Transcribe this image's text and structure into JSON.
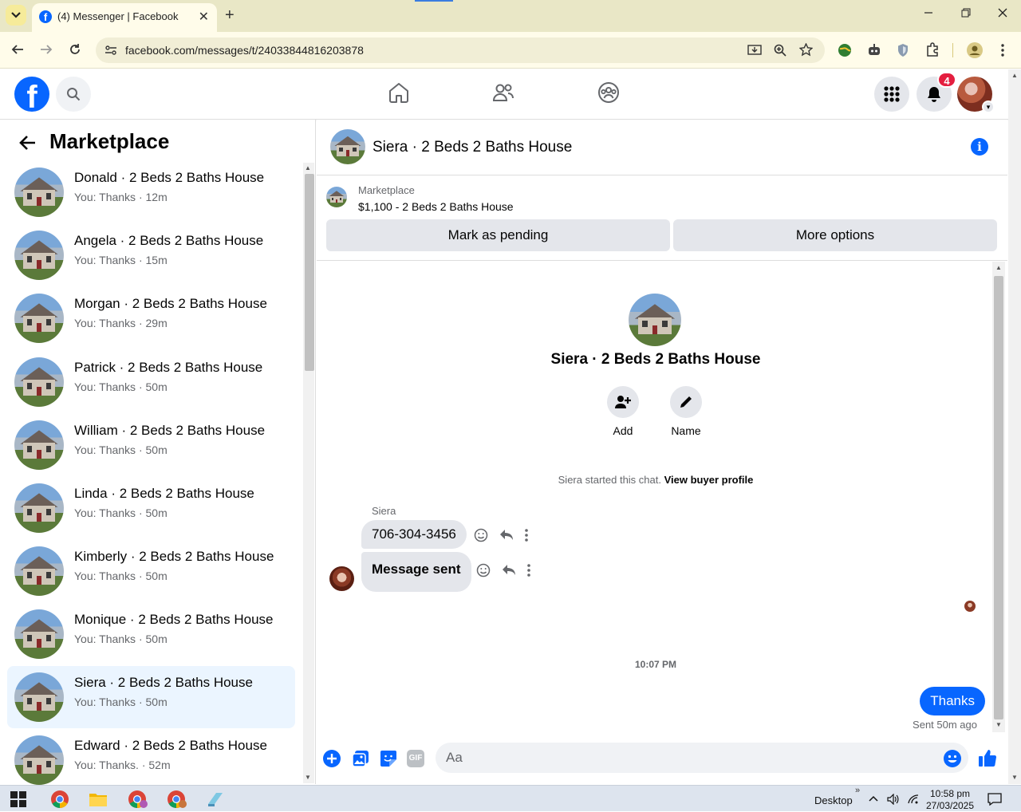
{
  "browser": {
    "tab_title": "(4) Messenger | Facebook",
    "url": "facebook.com/messages/t/24033844816203878",
    "new_tab_symbol": "+",
    "close_symbol": "✕"
  },
  "header": {
    "notification_count": "4"
  },
  "sidebar": {
    "title": "Marketplace",
    "conversations": [
      {
        "name": "Donald · 2 Beds 2 Baths House",
        "preview": "You: Thanks · 12m"
      },
      {
        "name": "Angela · 2 Beds 2 Baths House",
        "preview": "You: Thanks · 15m"
      },
      {
        "name": "Morgan · 2 Beds 2 Baths House",
        "preview": "You: Thanks · 29m"
      },
      {
        "name": "Patrick · 2 Beds 2 Baths House",
        "preview": "You: Thanks · 50m"
      },
      {
        "name": "William · 2 Beds 2 Baths House",
        "preview": "You: Thanks · 50m"
      },
      {
        "name": "Linda · 2 Beds 2 Baths House",
        "preview": "You: Thanks · 50m"
      },
      {
        "name": "Kimberly · 2 Beds 2 Baths House",
        "preview": "You: Thanks · 50m"
      },
      {
        "name": "Monique · 2 Beds 2 Baths House",
        "preview": "You: Thanks · 50m"
      },
      {
        "name": "Siera · 2 Beds 2 Baths House",
        "preview": "You: Thanks · 50m"
      },
      {
        "name": "Edward · 2 Beds 2 Baths House",
        "preview": "You: Thanks. · 52m"
      }
    ]
  },
  "chat": {
    "title": "Siera · 2 Beds 2 Baths House",
    "listing": {
      "category": "Marketplace",
      "description": "$1,100 - 2 Beds 2 Baths House",
      "mark_pending_label": "Mark as pending",
      "more_options_label": "More options"
    },
    "intro": {
      "title": "Siera · 2 Beds 2 Baths House",
      "add_label": "Add",
      "name_label": "Name",
      "started_text": "Siera started this chat.",
      "view_profile_link": "View buyer profile"
    },
    "messages": {
      "sender_name": "Siera",
      "incoming_1": "706-304-3456",
      "incoming_2": "Message sent",
      "timestamp": "10:07 PM",
      "outgoing": "Thanks",
      "sent_status": "Sent 50m ago"
    },
    "composer": {
      "placeholder": "Aa",
      "gif_label": "GIF"
    }
  },
  "taskbar": {
    "desktop_label": "Desktop",
    "time": "10:58 pm",
    "date": "27/03/2025",
    "overflow": "»"
  },
  "colors": {
    "accent": "#0866ff",
    "active_conversation_bg": "#ebf5ff",
    "notification_badge": "#e41e3f"
  }
}
